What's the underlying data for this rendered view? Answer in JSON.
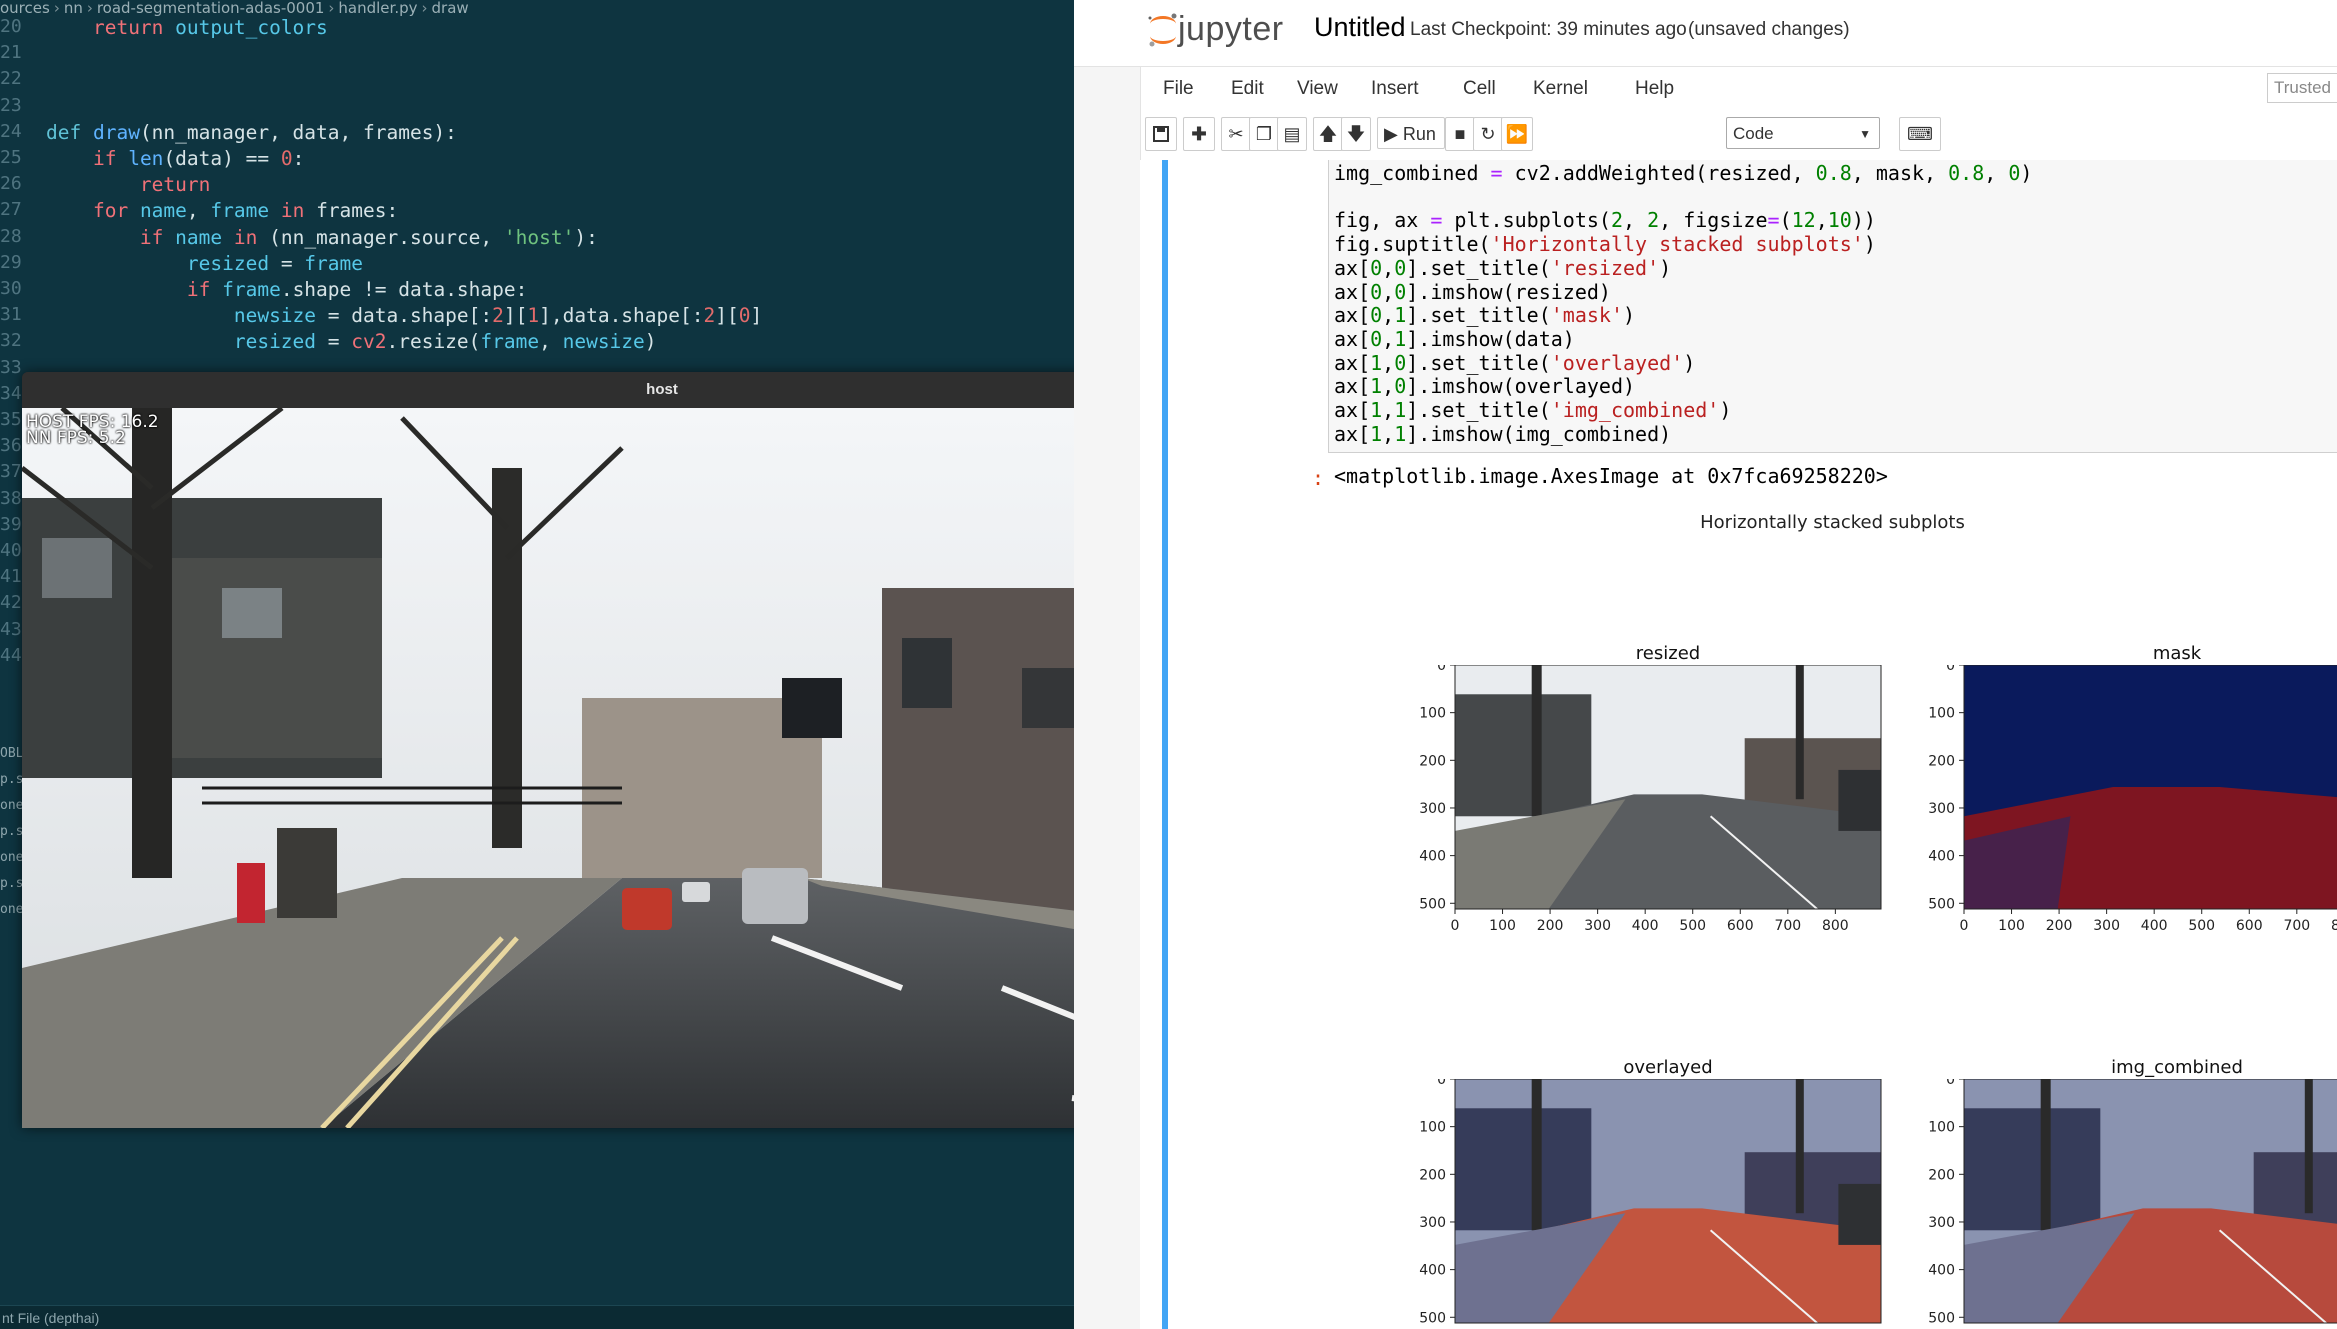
{
  "editor": {
    "breadcrumb": [
      "ources",
      "nn",
      "road-segmentation-adas-0001",
      "handler.py",
      "draw"
    ],
    "code_lines": [
      {
        "num": "20",
        "tokens": [
          {
            "t": "    ",
            "c": "tk-pl"
          },
          {
            "t": "return",
            "c": "tk-kw"
          },
          {
            "t": " output_colors",
            "c": "tk-var"
          }
        ]
      },
      {
        "num": "21",
        "tokens": []
      },
      {
        "num": "22",
        "tokens": []
      },
      {
        "num": "23",
        "tokens": []
      },
      {
        "num": "24",
        "tokens": [
          {
            "t": "def ",
            "c": "tk-kw2"
          },
          {
            "t": "draw",
            "c": "tk-fn"
          },
          {
            "t": "(nn_manager, data, frames):",
            "c": "tk-pl"
          }
        ]
      },
      {
        "num": "25",
        "tokens": [
          {
            "t": "    ",
            "c": "tk-pl"
          },
          {
            "t": "if ",
            "c": "tk-kw"
          },
          {
            "t": "len",
            "c": "tk-fn"
          },
          {
            "t": "(data) == ",
            "c": "tk-pl"
          },
          {
            "t": "0",
            "c": "tk-num"
          },
          {
            "t": ":",
            "c": "tk-pl"
          }
        ]
      },
      {
        "num": "26",
        "tokens": [
          {
            "t": "        ",
            "c": "tk-pl"
          },
          {
            "t": "return",
            "c": "tk-kw"
          }
        ]
      },
      {
        "num": "27",
        "tokens": [
          {
            "t": "    ",
            "c": "tk-pl"
          },
          {
            "t": "for ",
            "c": "tk-kw"
          },
          {
            "t": "name",
            "c": "tk-var"
          },
          {
            "t": ", ",
            "c": "tk-pl"
          },
          {
            "t": "frame ",
            "c": "tk-var"
          },
          {
            "t": "in ",
            "c": "tk-kw"
          },
          {
            "t": "frames:",
            "c": "tk-pl"
          }
        ]
      },
      {
        "num": "28",
        "tokens": [
          {
            "t": "        ",
            "c": "tk-pl"
          },
          {
            "t": "if ",
            "c": "tk-kw"
          },
          {
            "t": "name ",
            "c": "tk-var"
          },
          {
            "t": "in ",
            "c": "tk-kw"
          },
          {
            "t": "(nn_manager.source, ",
            "c": "tk-pl"
          },
          {
            "t": "'host'",
            "c": "tk-str"
          },
          {
            "t": "):",
            "c": "tk-pl"
          }
        ]
      },
      {
        "num": "29",
        "tokens": [
          {
            "t": "            ",
            "c": "tk-pl"
          },
          {
            "t": "resized ",
            "c": "tk-var"
          },
          {
            "t": "= ",
            "c": "tk-pl"
          },
          {
            "t": "frame",
            "c": "tk-var"
          }
        ]
      },
      {
        "num": "30",
        "tokens": [
          {
            "t": "            ",
            "c": "tk-pl"
          },
          {
            "t": "if ",
            "c": "tk-kw"
          },
          {
            "t": "frame",
            "c": "tk-var"
          },
          {
            "t": ".shape != data.shape:",
            "c": "tk-pl"
          }
        ]
      },
      {
        "num": "31",
        "tokens": [
          {
            "t": "                ",
            "c": "tk-pl"
          },
          {
            "t": "newsize ",
            "c": "tk-var"
          },
          {
            "t": "= data.shape[:",
            "c": "tk-pl"
          },
          {
            "t": "2",
            "c": "tk-num"
          },
          {
            "t": "][",
            "c": "tk-pl"
          },
          {
            "t": "1",
            "c": "tk-num"
          },
          {
            "t": "],data.shape[:",
            "c": "tk-pl"
          },
          {
            "t": "2",
            "c": "tk-num"
          },
          {
            "t": "][",
            "c": "tk-pl"
          },
          {
            "t": "0",
            "c": "tk-num"
          },
          {
            "t": "]",
            "c": "tk-pl"
          }
        ]
      },
      {
        "num": "32",
        "tokens": [
          {
            "t": "                ",
            "c": "tk-pl"
          },
          {
            "t": "resized ",
            "c": "tk-var"
          },
          {
            "t": "= ",
            "c": "tk-pl"
          },
          {
            "t": "cv2",
            "c": "tk-kw"
          },
          {
            "t": ".resize(",
            "c": "tk-pl"
          },
          {
            "t": "frame",
            "c": "tk-var"
          },
          {
            "t": ", ",
            "c": "tk-pl"
          },
          {
            "t": "newsize",
            "c": "tk-var"
          },
          {
            "t": ")",
            "c": "tk-pl"
          }
        ]
      },
      {
        "num": "33",
        "tokens": []
      }
    ],
    "hidden_line_numbers": [
      "34",
      "35",
      "36",
      "37",
      "38",
      "39",
      "40",
      "41",
      "42",
      "43",
      "44"
    ],
    "side_fragments": [
      "OBL",
      "p.s",
      "one",
      "p.s",
      "one",
      "p.s",
      "one"
    ],
    "status_text": "nt File (depthai)"
  },
  "host_window": {
    "title": "host",
    "minimize": "–",
    "close": "✕",
    "host_fps": "HOST FPS: 16.2",
    "nn_fps": "NN FPS:  5.2"
  },
  "jupyter": {
    "logo_text": "jupyter",
    "notebook_title": "Untitled",
    "checkpoint": "Last Checkpoint: 39 minutes ago",
    "unsaved": "(unsaved changes)",
    "menu": [
      "File",
      "Edit",
      "View",
      "Insert",
      "Cell",
      "Kernel",
      "Help"
    ],
    "trusted": "Trusted",
    "toolbar": {
      "run_label": "Run",
      "cell_type": "Code"
    },
    "code_lines": [
      [
        {
          "t": "img_combined ",
          "c": ""
        },
        {
          "t": "=",
          "c": "c-op"
        },
        {
          "t": " cv2.addWeighted(resized, ",
          "c": ""
        },
        {
          "t": "0.8",
          "c": "c-num"
        },
        {
          "t": ", mask, ",
          "c": ""
        },
        {
          "t": "0.8",
          "c": "c-num"
        },
        {
          "t": ", ",
          "c": ""
        },
        {
          "t": "0",
          "c": "c-num"
        },
        {
          "t": ")",
          "c": ""
        }
      ],
      [],
      [
        {
          "t": "fig, ax ",
          "c": ""
        },
        {
          "t": "=",
          "c": "c-op"
        },
        {
          "t": " plt.subplots(",
          "c": ""
        },
        {
          "t": "2",
          "c": "c-num"
        },
        {
          "t": ", ",
          "c": ""
        },
        {
          "t": "2",
          "c": "c-num"
        },
        {
          "t": ", figsize",
          "c": ""
        },
        {
          "t": "=",
          "c": "c-op"
        },
        {
          "t": "(",
          "c": ""
        },
        {
          "t": "12",
          "c": "c-num"
        },
        {
          "t": ",",
          "c": ""
        },
        {
          "t": "10",
          "c": "c-num"
        },
        {
          "t": "))",
          "c": ""
        }
      ],
      [
        {
          "t": "fig.suptitle(",
          "c": ""
        },
        {
          "t": "'Horizontally stacked subplots'",
          "c": "c-str"
        },
        {
          "t": ")",
          "c": ""
        }
      ],
      [
        {
          "t": "ax[",
          "c": ""
        },
        {
          "t": "0",
          "c": "c-num"
        },
        {
          "t": ",",
          "c": ""
        },
        {
          "t": "0",
          "c": "c-num"
        },
        {
          "t": "].set_title(",
          "c": ""
        },
        {
          "t": "'resized'",
          "c": "c-str"
        },
        {
          "t": ")",
          "c": ""
        }
      ],
      [
        {
          "t": "ax[",
          "c": ""
        },
        {
          "t": "0",
          "c": "c-num"
        },
        {
          "t": ",",
          "c": ""
        },
        {
          "t": "0",
          "c": "c-num"
        },
        {
          "t": "].imshow(resized)",
          "c": ""
        }
      ],
      [
        {
          "t": "ax[",
          "c": ""
        },
        {
          "t": "0",
          "c": "c-num"
        },
        {
          "t": ",",
          "c": ""
        },
        {
          "t": "1",
          "c": "c-num"
        },
        {
          "t": "].set_title(",
          "c": ""
        },
        {
          "t": "'mask'",
          "c": "c-str"
        },
        {
          "t": ")",
          "c": ""
        }
      ],
      [
        {
          "t": "ax[",
          "c": ""
        },
        {
          "t": "0",
          "c": "c-num"
        },
        {
          "t": ",",
          "c": ""
        },
        {
          "t": "1",
          "c": "c-num"
        },
        {
          "t": "].imshow(data)",
          "c": ""
        }
      ],
      [
        {
          "t": "ax[",
          "c": ""
        },
        {
          "t": "1",
          "c": "c-num"
        },
        {
          "t": ",",
          "c": ""
        },
        {
          "t": "0",
          "c": "c-num"
        },
        {
          "t": "].set_title(",
          "c": ""
        },
        {
          "t": "'overlayed'",
          "c": "c-str"
        },
        {
          "t": ")",
          "c": ""
        }
      ],
      [
        {
          "t": "ax[",
          "c": ""
        },
        {
          "t": "1",
          "c": "c-num"
        },
        {
          "t": ",",
          "c": ""
        },
        {
          "t": "0",
          "c": "c-num"
        },
        {
          "t": "].imshow(overlayed)",
          "c": ""
        }
      ],
      [
        {
          "t": "ax[",
          "c": ""
        },
        {
          "t": "1",
          "c": "c-num"
        },
        {
          "t": ",",
          "c": ""
        },
        {
          "t": "1",
          "c": "c-num"
        },
        {
          "t": "].set_title(",
          "c": ""
        },
        {
          "t": "'img_combined'",
          "c": "c-str"
        },
        {
          "t": ")",
          "c": ""
        }
      ],
      [
        {
          "t": "ax[",
          "c": ""
        },
        {
          "t": "1",
          "c": "c-num"
        },
        {
          "t": ",",
          "c": ""
        },
        {
          "t": "1",
          "c": "c-num"
        },
        {
          "t": "].imshow(img_combined)",
          "c": ""
        }
      ]
    ],
    "output_prompt": ":",
    "output_text": "<matplotlib.image.AxesImage at 0x7fca69258220>",
    "figure": {
      "suptitle": "Horizontally stacked subplots",
      "subplots": [
        {
          "title": "resized",
          "kind": "street"
        },
        {
          "title": "mask",
          "kind": "mask"
        },
        {
          "title": "overlayed",
          "kind": "overlay"
        },
        {
          "title": "img_combined",
          "kind": "combined"
        }
      ],
      "yticks": [
        "0",
        "100",
        "200",
        "300",
        "400",
        "500"
      ],
      "xticks": [
        "0",
        "100",
        "200",
        "300",
        "400",
        "500",
        "600",
        "700",
        "800"
      ],
      "xlim": [
        0,
        896
      ],
      "ylim": [
        512,
        0
      ]
    }
  },
  "colors": {
    "editor_bg": "#0e3440",
    "jupyter_cell_bar": "#42a5f5",
    "mask_bg": "#0a1a5c",
    "mask_road": "#7e1521",
    "jupyter_orange": "#f37726"
  }
}
